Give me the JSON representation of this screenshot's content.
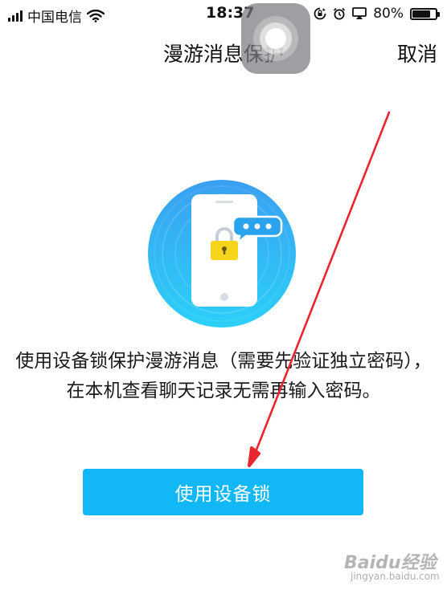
{
  "status_bar": {
    "carrier": "中国电信",
    "time": "18:37",
    "battery_percent": "80%",
    "battery_level": 0.8,
    "icons": [
      "signal-icon",
      "wifi-icon",
      "rotation-lock-icon",
      "alarm-icon",
      "airplay-icon",
      "battery-icon"
    ]
  },
  "nav": {
    "title": "漫游消息保护",
    "cancel_label": "取消"
  },
  "main": {
    "illustration_icon": "phone-lock-icon",
    "description": "使用设备锁保护漫游消息（需要先验证独立密码），在本机查看聊天记录无需再输入密码。",
    "primary_button_label": "使用设备锁"
  },
  "watermark": {
    "brand": "Baidu经验",
    "sub": "jingyan.baidu.com"
  },
  "colors": {
    "accent": "#12b7f5",
    "annotation": "#e8262d",
    "lock": "#f7d51b"
  }
}
